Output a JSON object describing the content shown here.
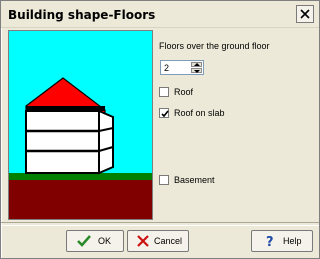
{
  "window": {
    "title": "Building shape-Floors"
  },
  "floors": {
    "label": "Floors over the ground floor",
    "value": "2"
  },
  "options": {
    "roof": {
      "label": "Roof",
      "checked": false
    },
    "roof_on_slab": {
      "label": "Roof on slab",
      "checked": true
    },
    "basement": {
      "label": "Basement",
      "checked": false
    }
  },
  "buttons": {
    "ok": "OK",
    "cancel": "Cancel",
    "help": "Help"
  },
  "colors": {
    "sky": "#00ffff",
    "roof": "#ff0000",
    "grass": "#008000",
    "soil": "#800000",
    "walls": "#ffffff",
    "ok_icon": "#2a8a2a",
    "cancel_icon": "#cc1111",
    "help_icon": "#1f4aa8"
  },
  "icons": {
    "close": "close-icon",
    "ok": "checkmark-icon",
    "cancel": "x-icon",
    "help": "question-mark-icon",
    "spinner_up": "triangle-up-icon",
    "spinner_down": "triangle-down-icon"
  }
}
